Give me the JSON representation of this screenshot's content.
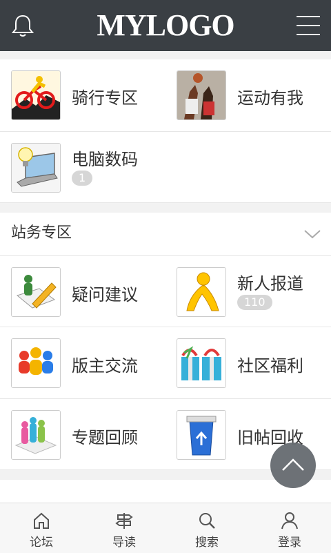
{
  "header": {
    "logo_text": "MYLOGO",
    "bell_icon": "bell-icon",
    "menu_icon": "menu-icon"
  },
  "forums_top": [
    {
      "label": "骑行专区",
      "icon": "cycling-icon"
    },
    {
      "label": "运动有我",
      "icon": "basketball-photo-icon"
    },
    {
      "label": "电脑数码",
      "icon": "laptop-bulb-icon",
      "badge": "1"
    }
  ],
  "section": {
    "title": "站务专区",
    "toggle_icon": "chevron-down-icon"
  },
  "forums_section": [
    {
      "label": "疑问建议",
      "icon": "pencil-note-icon"
    },
    {
      "label": "新人报道",
      "icon": "aim-person-icon",
      "badge": "110"
    },
    {
      "label": "版主交流",
      "icon": "group-people-icon"
    },
    {
      "label": "社区福利",
      "icon": "gift-boxes-icon"
    },
    {
      "label": "专题回顾",
      "icon": "people-chart-icon"
    },
    {
      "label": "旧帖回收",
      "icon": "recycle-bin-icon"
    }
  ],
  "fab_icon": "scroll-to-top-icon",
  "tabbar": [
    {
      "label": "论坛",
      "icon": "home-icon"
    },
    {
      "label": "导读",
      "icon": "signpost-icon"
    },
    {
      "label": "搜索",
      "icon": "search-icon"
    },
    {
      "label": "登录",
      "icon": "user-icon"
    }
  ],
  "colors": {
    "header_bg": "#3a3f44",
    "fab_bg": "#666b70",
    "badge_bg": "#d6d6d6"
  }
}
